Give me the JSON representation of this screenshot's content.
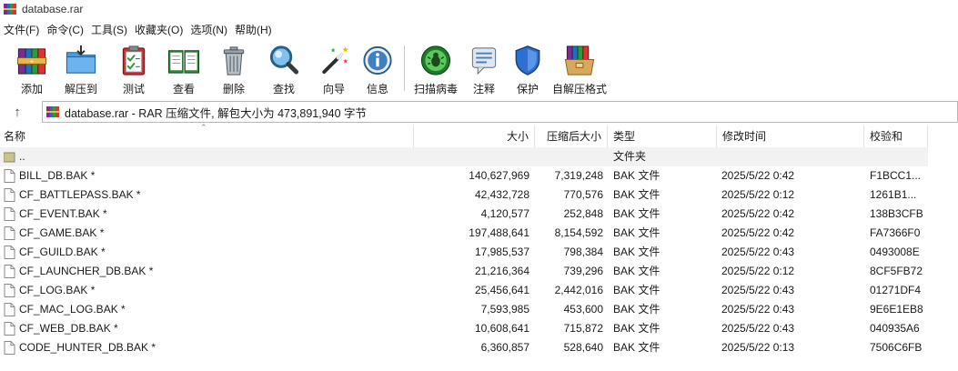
{
  "window": {
    "title": "database.rar"
  },
  "menu": [
    "文件(F)",
    "命令(C)",
    "工具(S)",
    "收藏夹(O)",
    "选项(N)",
    "帮助(H)"
  ],
  "toolbar": {
    "add": "添加",
    "extract_to": "解压到",
    "test": "测试",
    "view": "查看",
    "delete": "删除",
    "find": "查找",
    "wizard": "向导",
    "info": "信息",
    "virus_scan": "扫描病毒",
    "comment": "注释",
    "protect": "保护",
    "sfx": "自解压格式"
  },
  "address": {
    "path": "database.rar - RAR 压缩文件, 解包大小为 473,891,940 字节"
  },
  "columns": {
    "name": "名称",
    "size": "大小",
    "packed": "压缩后大小",
    "type": "类型",
    "modified": "修改时间",
    "crc": "校验和"
  },
  "parent_row": {
    "name": "..",
    "type": "文件夹"
  },
  "files": [
    {
      "name": "BILL_DB.BAK *",
      "size": "140,627,969",
      "packed": "7,319,248",
      "type": "BAK 文件",
      "modified": "2025/5/22 0:42",
      "crc": "F1BCC1..."
    },
    {
      "name": "CF_BATTLEPASS.BAK *",
      "size": "42,432,728",
      "packed": "770,576",
      "type": "BAK 文件",
      "modified": "2025/5/22 0:12",
      "crc": "1261B1..."
    },
    {
      "name": "CF_EVENT.BAK *",
      "size": "4,120,577",
      "packed": "252,848",
      "type": "BAK 文件",
      "modified": "2025/5/22 0:42",
      "crc": "138B3CFB"
    },
    {
      "name": "CF_GAME.BAK *",
      "size": "197,488,641",
      "packed": "8,154,592",
      "type": "BAK 文件",
      "modified": "2025/5/22 0:42",
      "crc": "FA7366F0"
    },
    {
      "name": "CF_GUILD.BAK *",
      "size": "17,985,537",
      "packed": "798,384",
      "type": "BAK 文件",
      "modified": "2025/5/22 0:43",
      "crc": "0493008E"
    },
    {
      "name": "CF_LAUNCHER_DB.BAK *",
      "size": "21,216,364",
      "packed": "739,296",
      "type": "BAK 文件",
      "modified": "2025/5/22 0:12",
      "crc": "8CF5FB72"
    },
    {
      "name": "CF_LOG.BAK *",
      "size": "25,456,641",
      "packed": "2,442,016",
      "type": "BAK 文件",
      "modified": "2025/5/22 0:43",
      "crc": "01271DF4"
    },
    {
      "name": "CF_MAC_LOG.BAK *",
      "size": "7,593,985",
      "packed": "453,600",
      "type": "BAK 文件",
      "modified": "2025/5/22 0:43",
      "crc": "9E6E1EB8"
    },
    {
      "name": "CF_WEB_DB.BAK *",
      "size": "10,608,641",
      "packed": "715,872",
      "type": "BAK 文件",
      "modified": "2025/5/22 0:43",
      "crc": "040935A6"
    },
    {
      "name": "CODE_HUNTER_DB.BAK *",
      "size": "6,360,857",
      "packed": "528,640",
      "type": "BAK 文件",
      "modified": "2025/5/22 0:13",
      "crc": "7506C6FB"
    }
  ]
}
